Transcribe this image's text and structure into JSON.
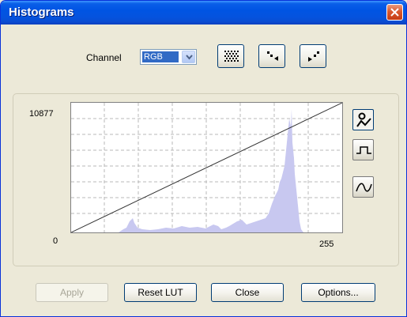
{
  "window": {
    "title": "Histograms"
  },
  "channel": {
    "label": "Channel",
    "selected": "RGB"
  },
  "toolbar": {
    "grid_icon": "dotted-grid-icon",
    "points_left_icon": "points-arrow-left-icon",
    "points_right_icon": "points-arrow-right-icon"
  },
  "histogram": {
    "y_max_label": "10877",
    "x_min_label": "0",
    "x_max_label": "255",
    "fill_color": "#c8c8f0",
    "line_color": "#333333"
  },
  "side_tools": [
    "curve-edit-icon",
    "step-function-icon",
    "wave-curve-icon"
  ],
  "buttons": {
    "apply": "Apply",
    "reset_lut": "Reset LUT",
    "close": "Close",
    "options": "Options..."
  },
  "colors": {
    "titlebar": "#0054e3",
    "dialog_bg": "#ece9d8",
    "selection": "#316ac5"
  }
}
